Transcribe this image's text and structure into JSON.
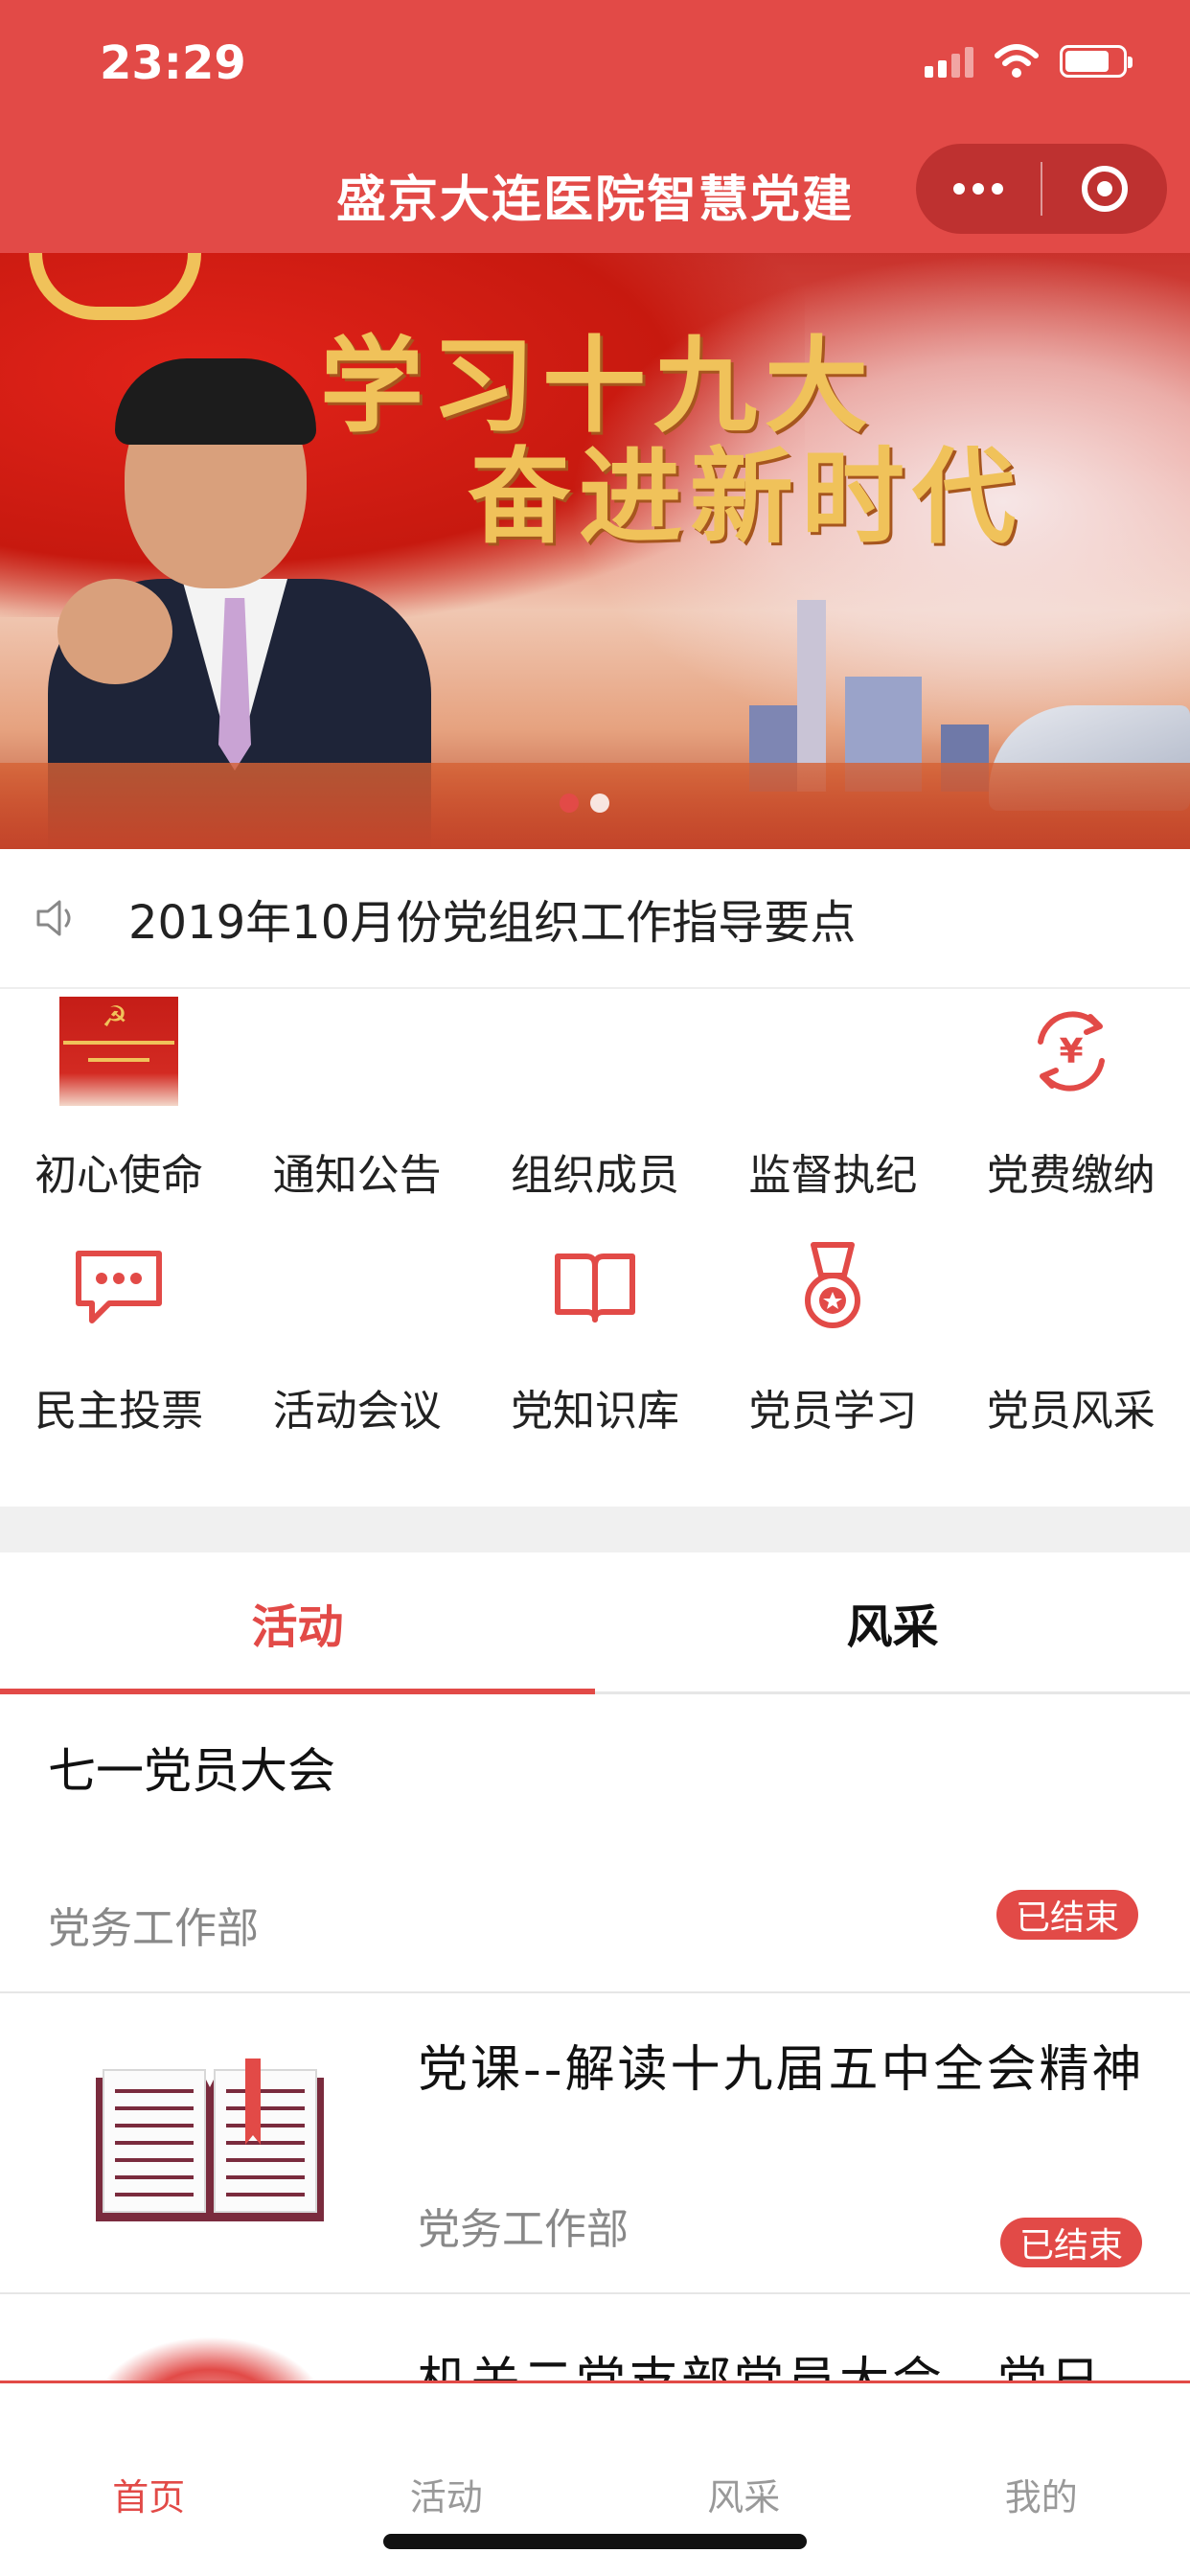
{
  "status_bar": {
    "time": "23:29"
  },
  "header": {
    "title": "盛京大连医院智慧党建"
  },
  "banner": {
    "title_line1": "学习十九大",
    "title_line2": "奋进新时代",
    "dot_count": 2,
    "active_dot": 0
  },
  "notice": {
    "text": "2019年10月份党组织工作指导要点",
    "icon": "speaker-icon"
  },
  "grid": [
    {
      "label": "初心使命",
      "icon": "party-mission-image"
    },
    {
      "label": "通知公告",
      "icon": "notice-icon"
    },
    {
      "label": "组织成员",
      "icon": "members-icon"
    },
    {
      "label": "监督执纪",
      "icon": "supervision-icon"
    },
    {
      "label": "党费缴纳",
      "icon": "yuan-payment-icon"
    },
    {
      "label": "民主投票",
      "icon": "chat-bubble-icon"
    },
    {
      "label": "活动会议",
      "icon": "meeting-icon"
    },
    {
      "label": "党知识库",
      "icon": "book-icon"
    },
    {
      "label": "党员学习",
      "icon": "medal-icon"
    },
    {
      "label": "党员风采",
      "icon": "style-icon"
    }
  ],
  "tabs": [
    {
      "label": "活动",
      "active": true
    },
    {
      "label": "风采",
      "active": false
    }
  ],
  "activities": [
    {
      "title": "七一党员大会",
      "dept": "党务工作部",
      "status": "已结束"
    },
    {
      "title": "党课--解读十九届五中全会精神",
      "dept": "党务工作部",
      "status": "已结束"
    },
    {
      "title": "机关二党支部党员大会、党日"
    }
  ],
  "tabbar": [
    {
      "label": "首页",
      "active": true
    },
    {
      "label": "活动",
      "active": false
    },
    {
      "label": "风采",
      "active": false
    },
    {
      "label": "我的",
      "active": false
    }
  ],
  "colors": {
    "primary": "#e24a47",
    "muted_text": "#888888",
    "divider": "#e6e6e6"
  }
}
